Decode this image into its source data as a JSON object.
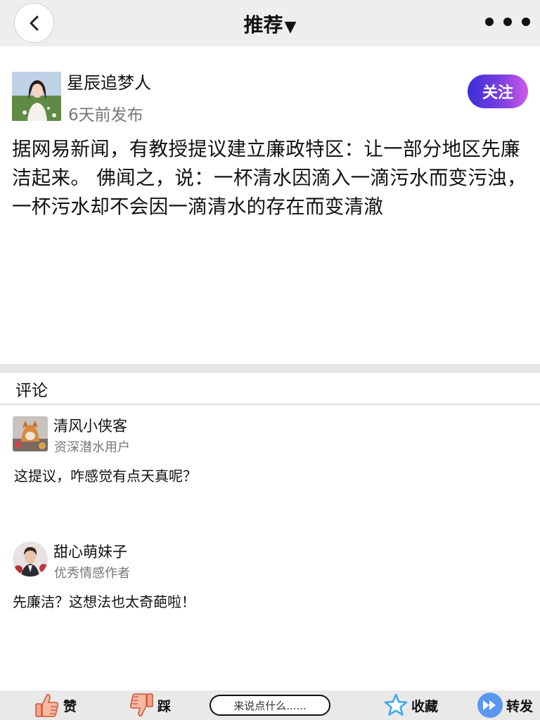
{
  "header": {
    "title": "推荐",
    "caret": "▼"
  },
  "post": {
    "author": "星辰追梦人",
    "time": "6天前发布",
    "follow_label": "关注",
    "body": "据网易新闻，有教授提议建立廉政特区：让一部分地区先廉洁起来。 佛闻之，说：一杯清水因滴入一滴污水而变污浊，一杯污水却不会因一滴清水的存在而变清澈"
  },
  "comments": {
    "section_label": "评论",
    "items": [
      {
        "name": "清风小侠客",
        "subtitle": "资深潜水用户",
        "text": "这提议，咋感觉有点天真呢？"
      },
      {
        "name": "甜心萌妹子",
        "subtitle": "优秀情感作者",
        "text": "先廉洁？这想法也太奇葩啦！"
      }
    ]
  },
  "bottom_bar": {
    "like_label": "赞",
    "dislike_label": "踩",
    "input_placeholder": "来说点什么......",
    "favorite_label": "收藏",
    "share_label": "转发"
  },
  "colors": {
    "follow_gradient_start": "#3b2fd6",
    "follow_gradient_end": "#d15ae8",
    "share_icon": "#4a8ff0",
    "favorite_icon": "#3fa9ee",
    "like_icon": "#f4a58a"
  },
  "icons": [
    "chevron-left-icon",
    "more-dots-icon",
    "thumbs-up-icon",
    "thumbs-down-icon",
    "star-icon",
    "forward-icon"
  ]
}
